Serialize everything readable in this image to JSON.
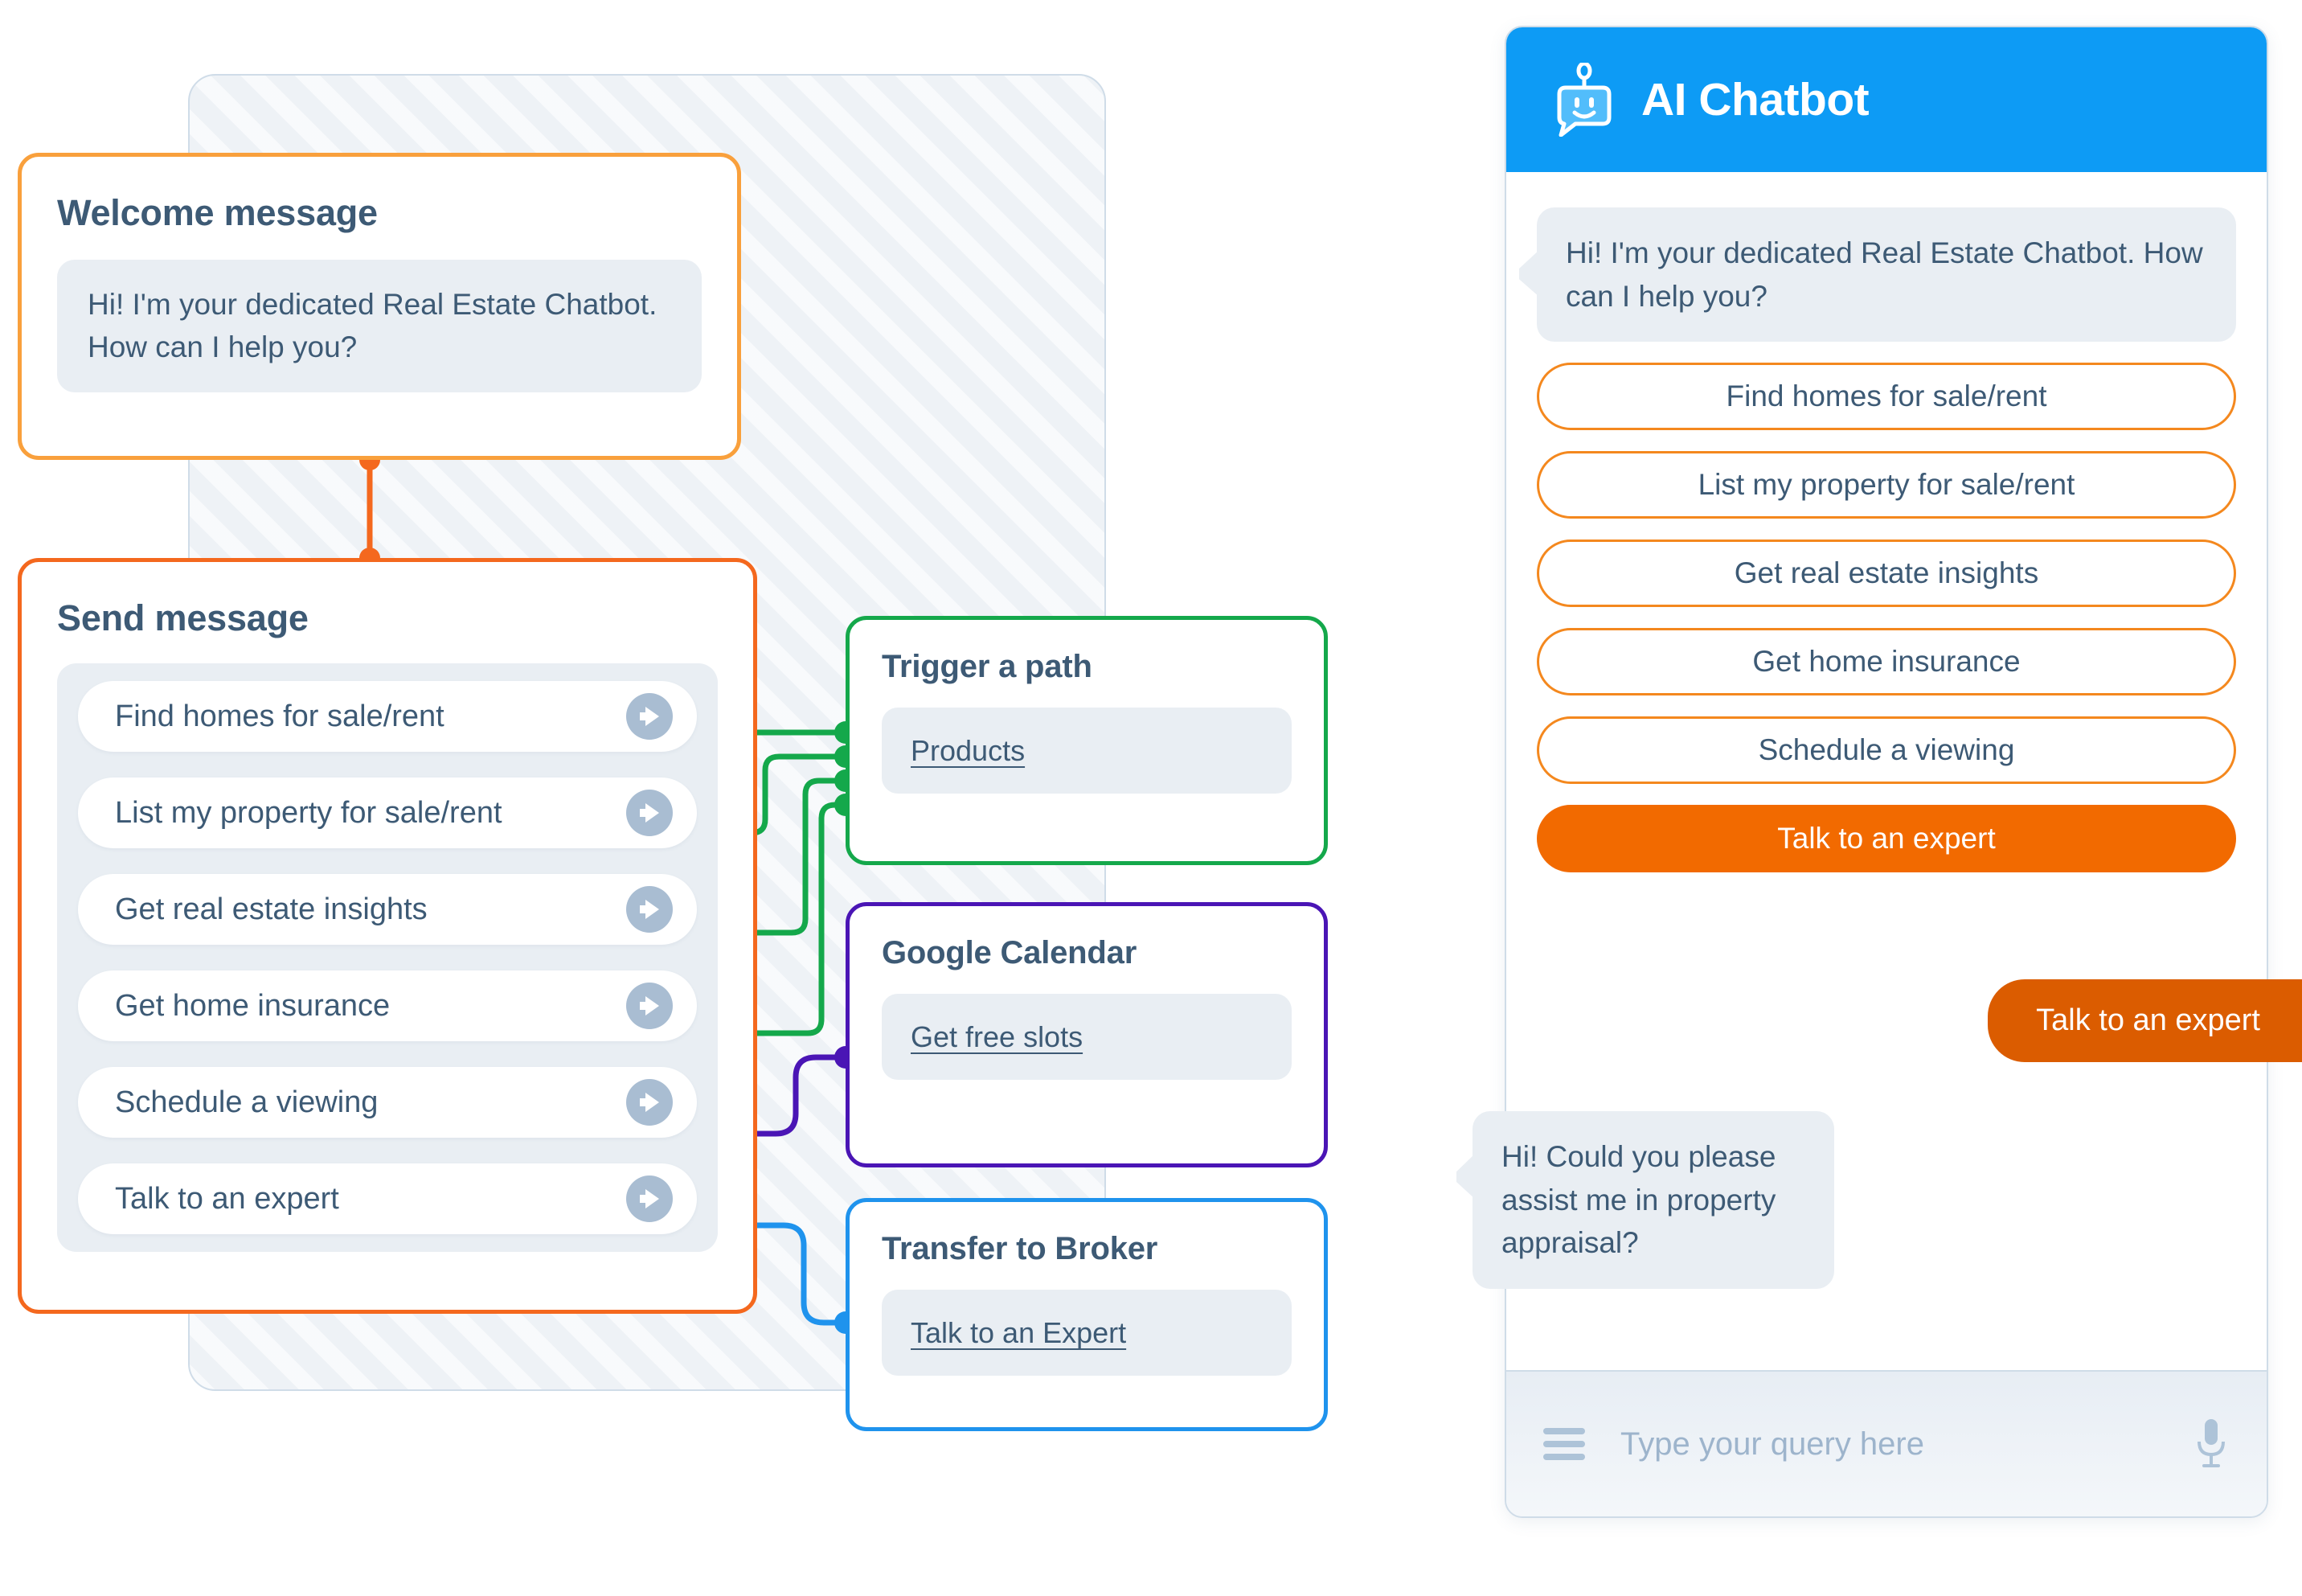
{
  "flow": {
    "welcome_card": {
      "title": "Welcome message",
      "message": "Hi! I'm your dedicated Real Estate Chatbot. How can I help you?"
    },
    "send_card": {
      "title": "Send message",
      "options": [
        {
          "label": "Find homes for sale/rent",
          "connector_color": "#14a84b"
        },
        {
          "label": "List my property for sale/rent",
          "connector_color": "#14a84b"
        },
        {
          "label": "Get real estate insights",
          "connector_color": "#14a84b"
        },
        {
          "label": "Get home insurance",
          "connector_color": "#14a84b"
        },
        {
          "label": "Schedule a viewing",
          "connector_color": "#4a15b5"
        },
        {
          "label": "Talk to an expert",
          "connector_color": "#1f93ed"
        }
      ]
    },
    "trigger_card": {
      "title": "Trigger a path",
      "value": "Products"
    },
    "calendar_card": {
      "title": "Google Calendar",
      "value": "Get free slots"
    },
    "broker_card": {
      "title": "Transfer to Broker",
      "value": "Talk to an Expert"
    }
  },
  "chat": {
    "title": "AI Chatbot",
    "header_color": "#0d9bf5",
    "bot_message_1": "Hi! I'm your dedicated Real Estate Chatbot. How can I help you?",
    "quick_replies": [
      {
        "label": "Find homes for sale/rent",
        "selected": false
      },
      {
        "label": "List my property for sale/rent",
        "selected": false
      },
      {
        "label": "Get real estate insights",
        "selected": false
      },
      {
        "label": "Get home insurance",
        "selected": false
      },
      {
        "label": "Schedule a viewing",
        "selected": false
      },
      {
        "label": "Talk to an expert",
        "selected": true
      }
    ],
    "user_message": "Talk to an expert",
    "bot_message_2": "Hi! Could you please assist me in property appraisal?",
    "input_placeholder": "Type your query here"
  },
  "colors": {
    "welcome_border": "#f9a03c",
    "send_border": "#f4681e",
    "trigger_border": "#14a84b",
    "calendar_border": "#4a15b5",
    "broker_border": "#1f93ed",
    "accent_orange": "#f26a00",
    "chat_blue": "#0d9bf5",
    "text_slate": "#3d5a75"
  }
}
